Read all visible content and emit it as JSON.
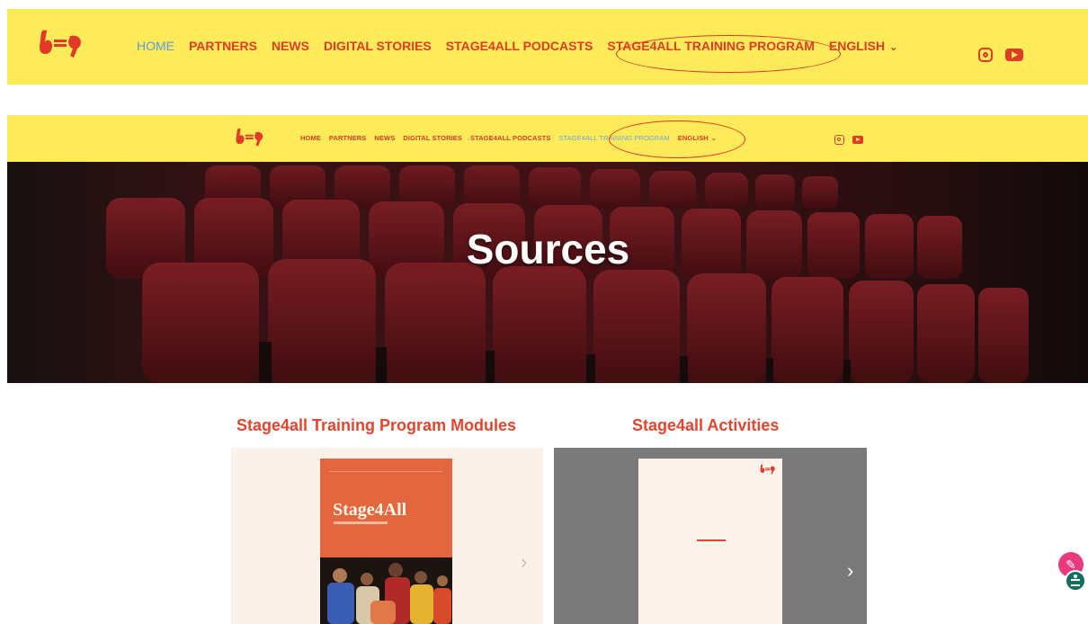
{
  "nav_primary": {
    "items": [
      "HOME",
      "PARTNERS",
      "NEWS",
      "DIGITAL STORIES",
      "STAGE4ALL PODCASTS",
      "STAGE4ALL TRAINING PROGRAM",
      "ENGLISH"
    ]
  },
  "nav_secondary": {
    "items": [
      "HOME",
      "PARTNERS",
      "NEWS",
      "DIGITAL STORIES",
      "STAGE4ALL PODCASTS",
      "STAGE4ALL TRAINING PROGRAM",
      "ENGLISH"
    ]
  },
  "hero": {
    "title": "Sources"
  },
  "sections": [
    {
      "title": "Stage4all Training Program Modules",
      "book_title": "Stage4All"
    },
    {
      "title": "Stage4all Activities"
    }
  ],
  "colors": {
    "nav_bg": "#fdeb5a",
    "accent_red": "#e23a28",
    "active_blue": "#5a9ee0",
    "section_title": "#e4452d"
  },
  "icons": [
    "logo",
    "instagram-icon",
    "youtube-icon",
    "chevron-down-icon",
    "arrow-right-icon",
    "edit-fab-icon",
    "accessibility-icon"
  ]
}
